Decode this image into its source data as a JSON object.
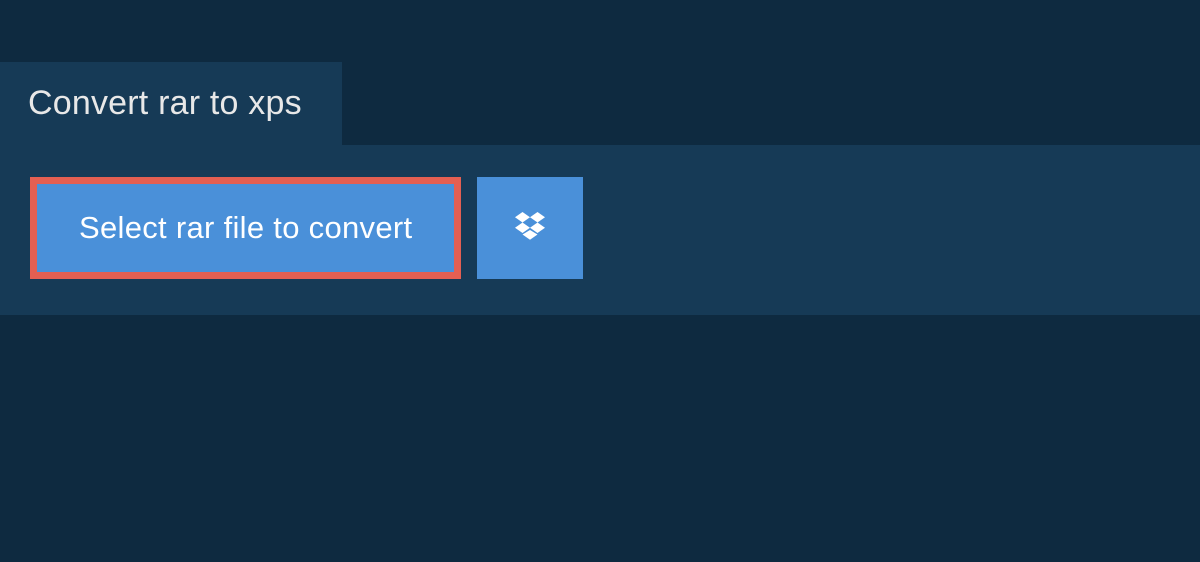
{
  "header": {
    "tab_label": "Convert rar to xps"
  },
  "actions": {
    "select_file_label": "Select rar file to convert",
    "dropbox_icon": "dropbox-icon"
  },
  "colors": {
    "bg_dark": "#0e2a40",
    "panel": "#163a56",
    "primary_button": "#4a90d9",
    "highlight_border": "#e45f52"
  }
}
